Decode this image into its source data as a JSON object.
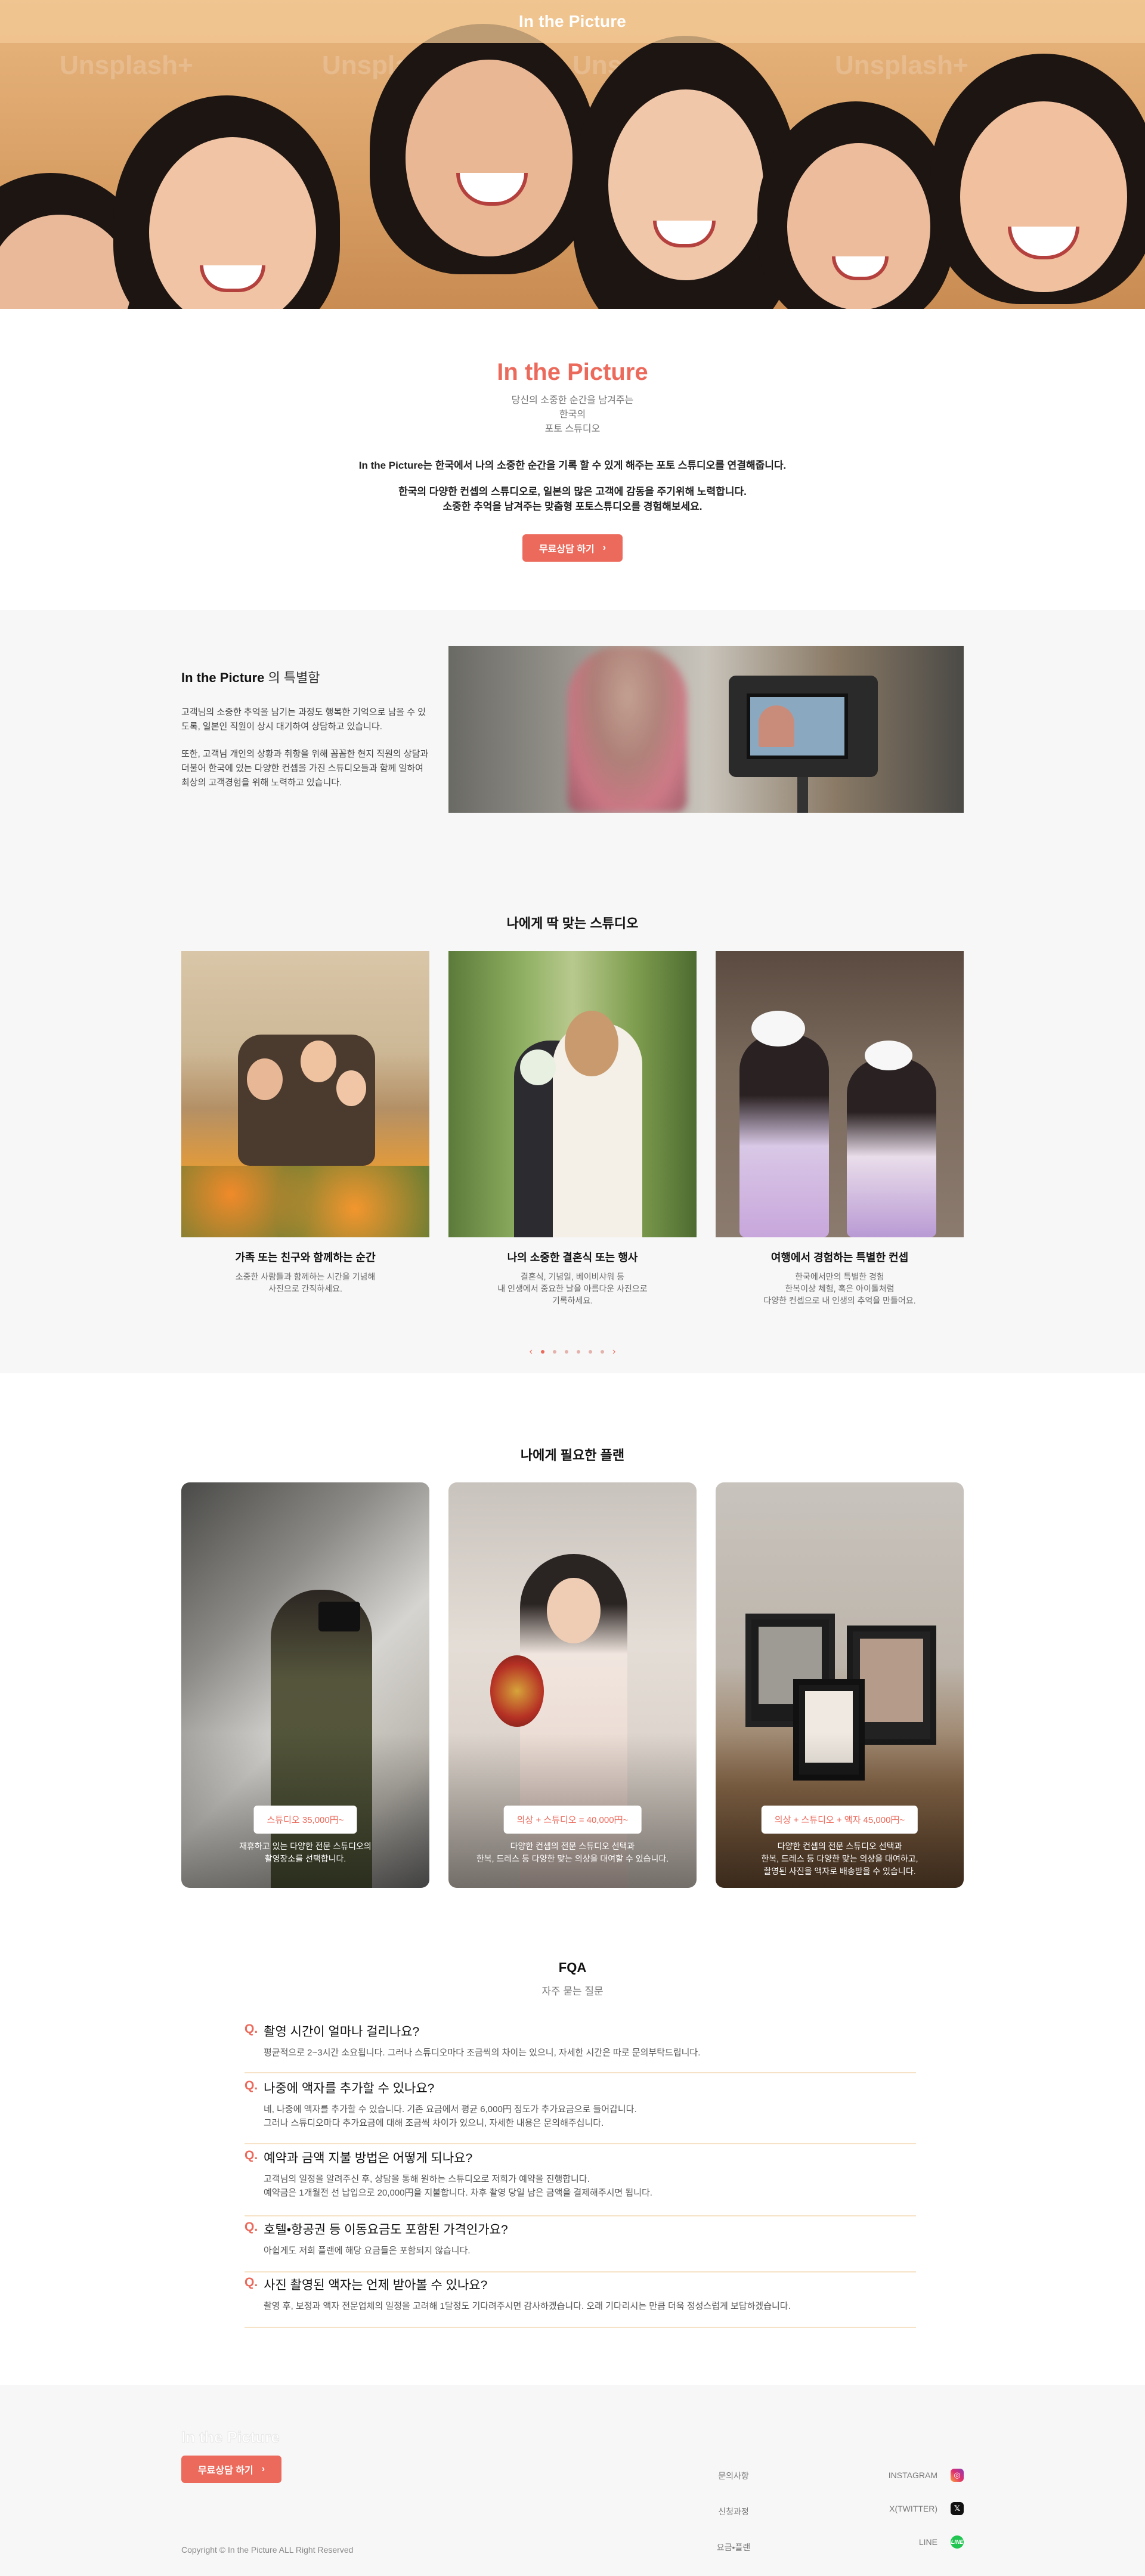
{
  "header": {
    "brand": "In the Picture"
  },
  "hero": {
    "watermark": "Unsplash+"
  },
  "intro": {
    "title": "In the Picture",
    "subtitle_lines": [
      "당신의 소중한 순간을 남겨주는",
      "한국의",
      "포토 스튜디오"
    ],
    "paragraph1": "In the Picture는  한국에서 나의 소중한 순간을 기록 할 수 있게 해주는 포토 스튜디오를 연결해줍니다.",
    "paragraph2_lines": [
      "한국의 다양한 컨셉의 스튜디오로, 일본의 많은 고객에 감동을 주기위해 노력합니다.",
      "소중한 추억을 남겨주는 맞춤형 포토스튜디오를 경험해보세요."
    ],
    "cta": "무료상담 하기"
  },
  "special": {
    "title_bold": "In the Picture",
    "title_rest": " 의 특별함",
    "text1": "고객님의 소중한 추억을 남기는 과정도 행복한 기억으로 남을 수 있도록, 일본인 직원이 상시 대기하여 상담하고 있습니다.",
    "text2": "또한, 고객님 개인의 상황과 취향을 위해 꼼꼼한 현지 직원의 상담과 더불어 한국에 있는 다양한 컨셉을 가진 스튜디오들과 함께 일하여 최상의 고객경험을 위해 노력하고 있습니다."
  },
  "studios": {
    "title": "나에게 딱 맞는 스튜디오",
    "cards": [
      {
        "title": "가족 또는 친구와 함께하는 순간",
        "desc": "소중한 사람들과 함께하는 시간을 기념해\n사진으로 간직하세요."
      },
      {
        "title": "나의 소중한 결혼식 또는 행사",
        "desc": "결혼식, 기념일, 베이비샤워 등\n내 인생에서 중요한 날을 아름다운 사진으로\n기록하세요."
      },
      {
        "title": "여행에서 경험하는 특별한 컨셉",
        "desc": "한국에서만의 특별한 경험\n한복이상 체험, 혹은 아이돌처럼\n다양한 컨셉으로 내 인생의 추억을 만들어요."
      }
    ],
    "pagination": {
      "prev": "‹",
      "next": "›",
      "count": 6,
      "active": 0
    }
  },
  "plans": {
    "title": "나에게 필요한 플랜",
    "cards": [
      {
        "price": "스튜디오 35,000円~",
        "desc": "재휴하고 있는 다양한 전문 스튜디오의\n촬영장소를 선택합니다."
      },
      {
        "price": "의상 + 스튜디오 = 40,000円~",
        "desc": "다양한 컨셉의 전문 스튜디오 선택과\n한복, 드레스 등 다양한 맞는 의상을 대여할 수 있습니다."
      },
      {
        "price": "의상 + 스튜디오 + 액자 45,000円~",
        "desc": "다양한 컨셉의 전문 스튜디오 선택과\n한복, 드레스 등 다양한 맞는 의상을 대여하고,\n촬영된 사진을 액자로 배송받을 수 있습니다."
      }
    ]
  },
  "faq": {
    "title": "FQA",
    "subtitle": "자주 묻는 질문",
    "q_mark": "Q.",
    "items": [
      {
        "q": "촬영 시간이 얼마나 걸리나요?",
        "a": "평균적으로 2~3시간 소요됩니다. 그러나 스튜디오마다 조금씩의 차이는 있으니, 자세한 시간은 따로 문의부탁드립니다."
      },
      {
        "q": "나중에 액자를 추가할 수 있나요?",
        "a": "네, 나중에 액자를 추가할 수 있습니다. 기존 요금에서 평균 6,000円 정도가 추가요금으로 들어갑니다.\n그러나 스튜디오마다 추가요금에 대해 조금씩 차이가 있으니, 자세한 내용은 문의해주십니다."
      },
      {
        "q": "예약과 금액 지불 방법은 어떻게 되나요?",
        "a": "고객님의 일정을 알려주신 후, 상담을 통해 원하는 스튜디오로 저희가 예약을 진행합니다.\n예약금은 1개월전 선 납입으로 20,000円을 지불합니다. 차후 촬영 당일 남은 금액을 결제해주시면 됩니다."
      },
      {
        "q": "호텔•항공권 등 이동요금도 포함된 가격인가요?",
        "a": "아쉽게도 저희 플랜에 해당 요금들은 포함되지 않습니다."
      },
      {
        "q": "사진 촬영된 액자는 언제 받아볼 수 있나요?",
        "a": "촬영 후, 보정과 액자 전문업체의 일정을 고려해 1달정도 기다려주시면 감사하겠습니다. 오래 기다리시는 만큼 더욱 정성스럽게 보답하겠습니다."
      }
    ]
  },
  "footer": {
    "logo": "In the Picture",
    "cta": "무료상담 하기",
    "copyright": "Copyright © In the Picture ALL Right Reserved",
    "links": [
      "문의사항",
      "신청과정",
      "요금•플랜"
    ],
    "social": [
      {
        "label": "INSTAGRAM",
        "icon": "instagram-icon",
        "glyph": "◎"
      },
      {
        "label": "X(TWITTER)",
        "icon": "x-twitter-icon",
        "glyph": "𝕏"
      },
      {
        "label": "LINE",
        "icon": "line-icon",
        "glyph": "LINE"
      }
    ]
  },
  "colors": {
    "accent": "#ec6a5c",
    "hero_bg": "#e8b67f",
    "section_bg": "#f7f7f7",
    "faq_divider": "#f6e3c7"
  }
}
